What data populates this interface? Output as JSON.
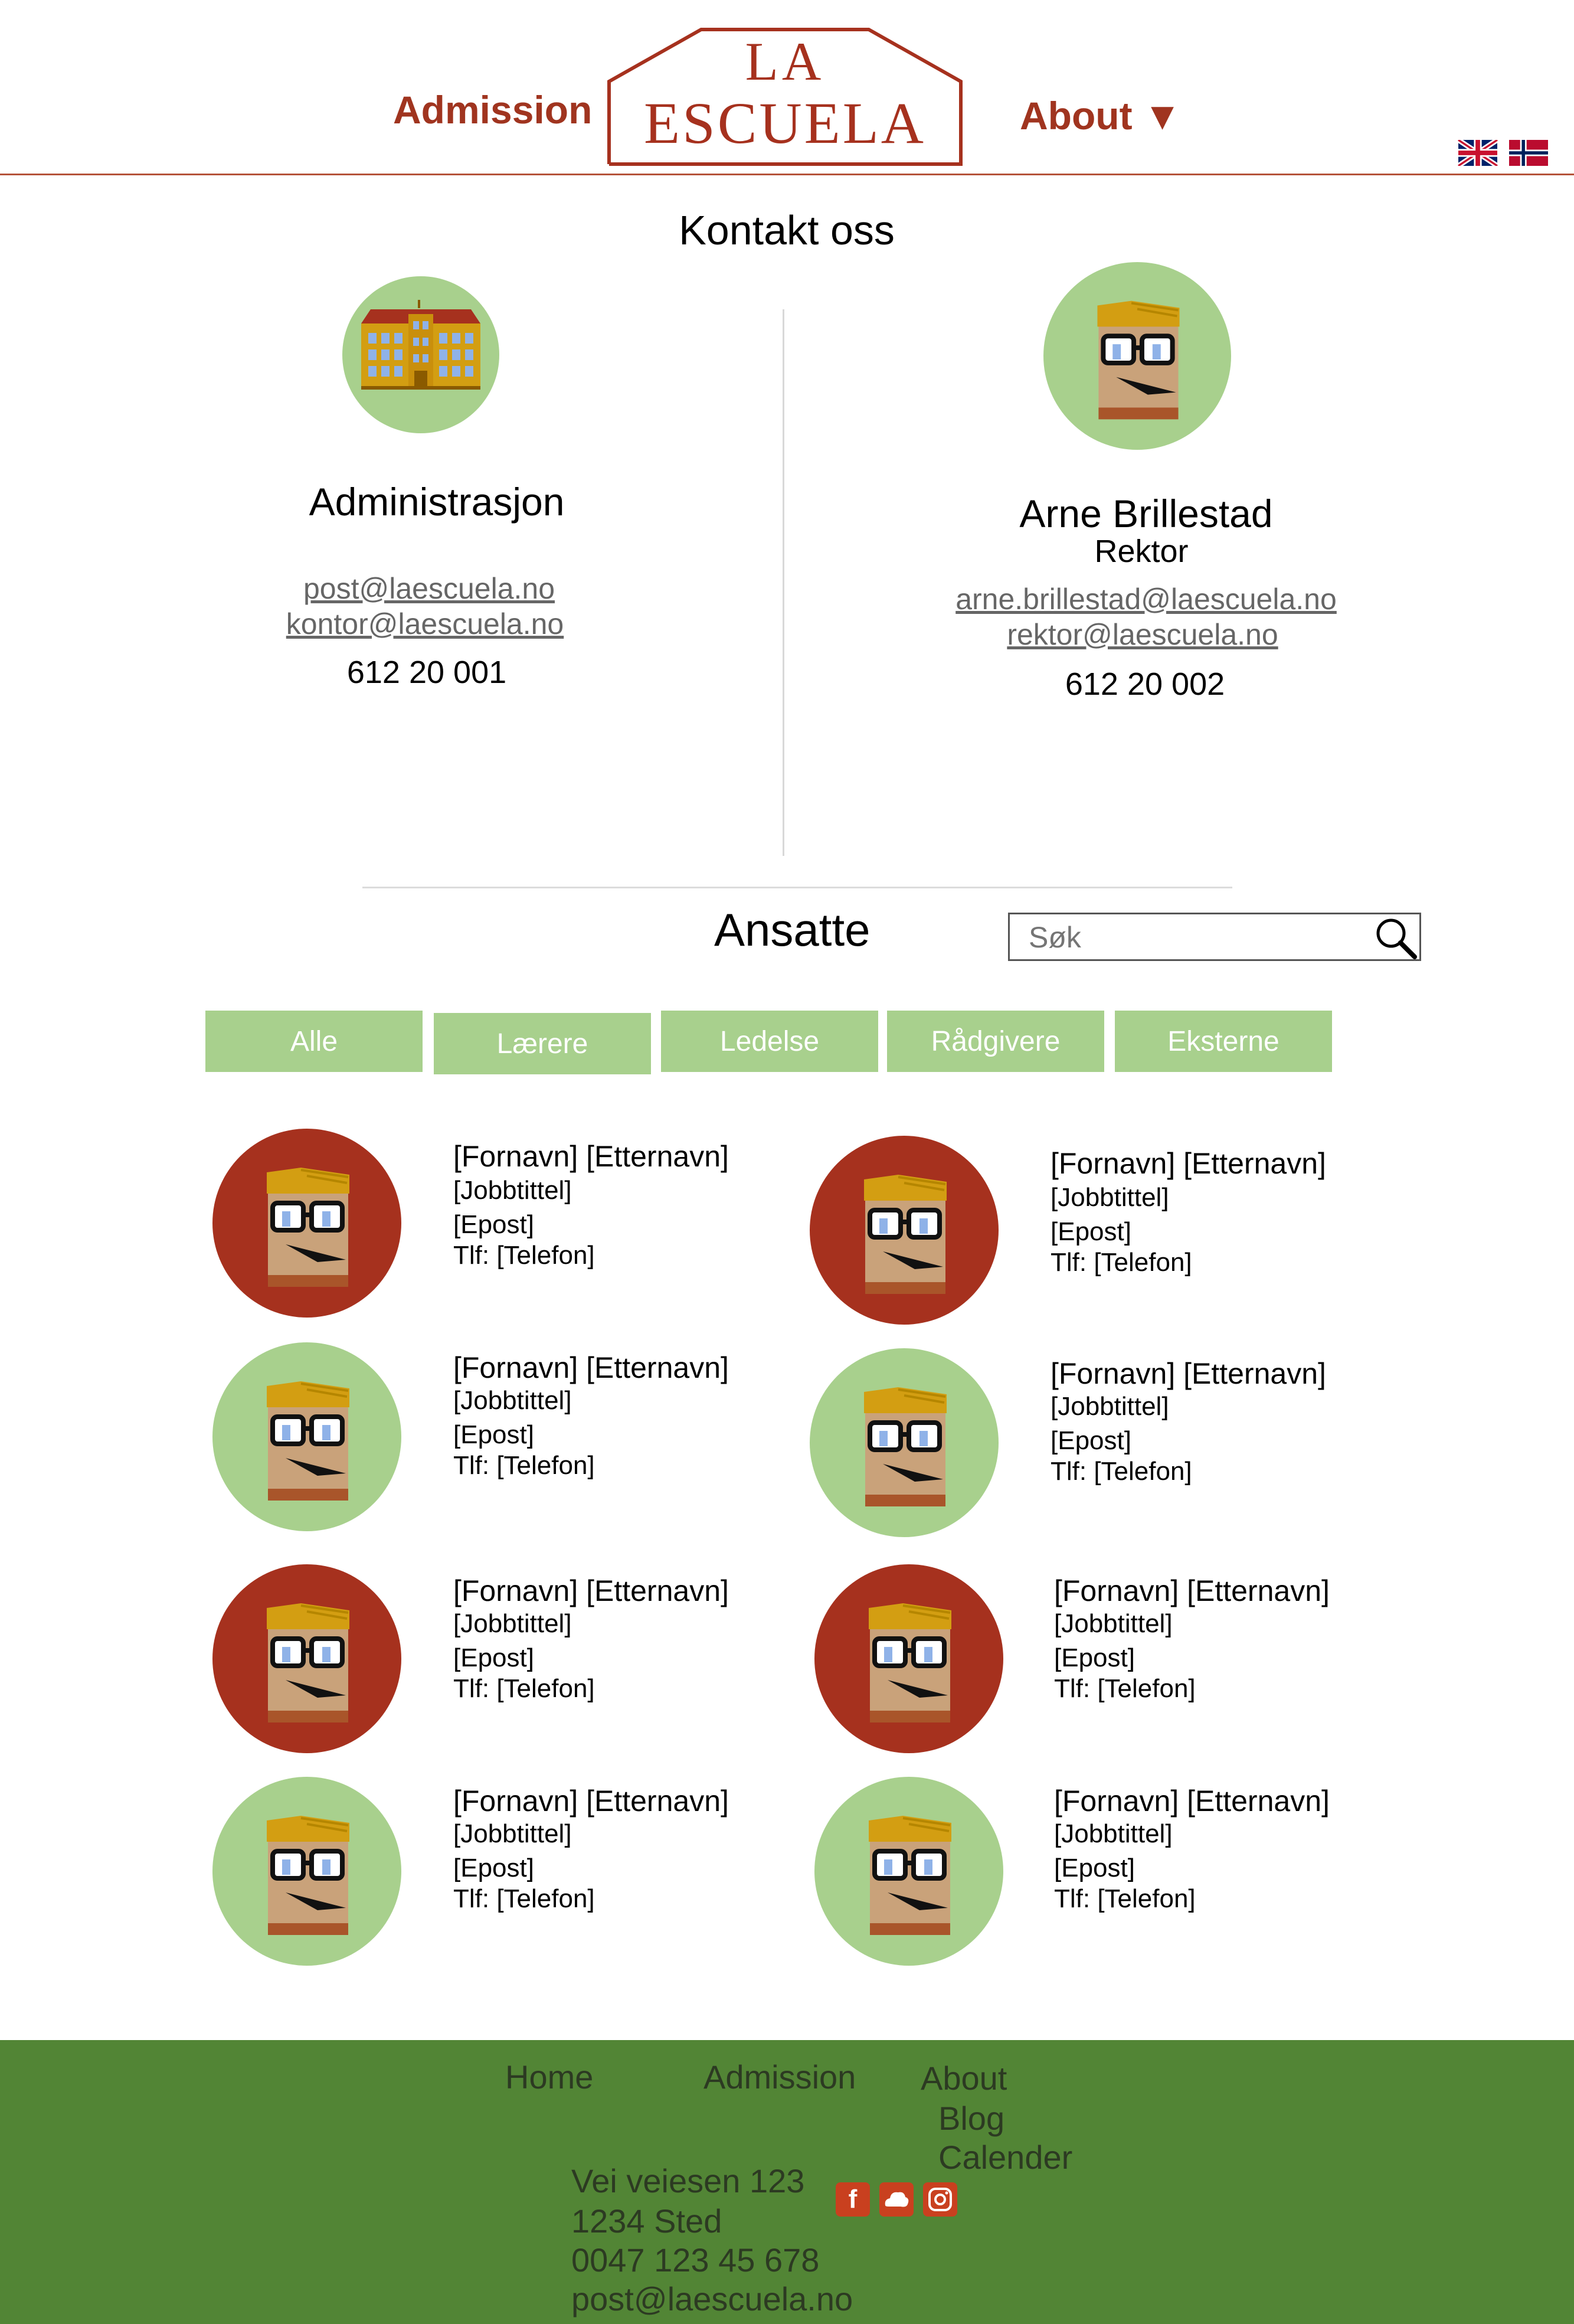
{
  "header": {
    "admission_label": "Admission",
    "about_label": "About ▼",
    "logo_line1": "LA",
    "logo_line2": "ESCUELA",
    "flags": [
      "uk-flag-icon",
      "norway-flag-icon"
    ]
  },
  "contact": {
    "title": "Kontakt oss",
    "admin": {
      "name": "Administrasjon",
      "emails": [
        "post@laescuela.no",
        "kontor@laescuela.no"
      ],
      "phone": "612 20 001"
    },
    "principal": {
      "name": "Arne Brillestad",
      "role": "Rektor",
      "emails": [
        "arne.brillestad@laescuela.no",
        "rektor@laescuela.no"
      ],
      "phone": "612 20 002"
    }
  },
  "staff": {
    "title": "Ansatte",
    "search_placeholder": "Søk",
    "filters": [
      "Alle",
      "Lærere",
      "Ledelse",
      "Rådgivere",
      "Eksterne"
    ],
    "cards": [
      {
        "name": "[Fornavn] [Etternavn]",
        "job": "[Jobbtittel]",
        "email": "[Epost]",
        "phone": "Tlf: [Telefon]",
        "color": "#a6311e"
      },
      {
        "name": "[Fornavn] [Etternavn]",
        "job": "[Jobbtittel]",
        "email": "[Epost]",
        "phone": "Tlf: [Telefon]",
        "color": "#a6311e"
      },
      {
        "name": "[Fornavn] [Etternavn]",
        "job": "[Jobbtittel]",
        "email": "[Epost]",
        "phone": "Tlf: [Telefon]",
        "color": "#a8d08d"
      },
      {
        "name": "[Fornavn] [Etternavn]",
        "job": "[Jobbtittel]",
        "email": "[Epost]",
        "phone": "Tlf: [Telefon]",
        "color": "#a8d08d"
      },
      {
        "name": "[Fornavn] [Etternavn]",
        "job": "[Jobbtittel]",
        "email": "[Epost]",
        "phone": "Tlf: [Telefon]",
        "color": "#a6311e"
      },
      {
        "name": "[Fornavn] [Etternavn]",
        "job": "[Jobbtittel]",
        "email": "[Epost]",
        "phone": "Tlf: [Telefon]",
        "color": "#a6311e"
      },
      {
        "name": "[Fornavn] [Etternavn]",
        "job": "[Jobbtittel]",
        "email": "[Epost]",
        "phone": "Tlf: [Telefon]",
        "color": "#a8d08d"
      },
      {
        "name": "[Fornavn] [Etternavn]",
        "job": "[Jobbtittel]",
        "email": "[Epost]",
        "phone": "Tlf: [Telefon]",
        "color": "#a8d08d"
      }
    ]
  },
  "footer": {
    "nav": {
      "home": "Home",
      "admission": "Admission",
      "about": "About",
      "blog": "Blog",
      "calender": "Calender"
    },
    "address": [
      "Vei veiesen 123",
      "1234 Sted",
      "0047 123 45 678",
      "post@laescuela.no"
    ],
    "social": [
      "facebook-icon",
      "twitter-icon",
      "instagram-icon"
    ]
  },
  "colors": {
    "brand_red": "#a6311e",
    "brand_green": "#a8d08d",
    "footer_green": "#528535"
  }
}
